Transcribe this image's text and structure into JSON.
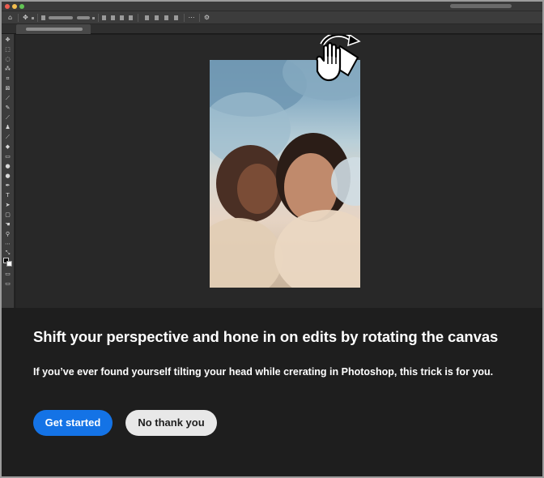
{
  "window": {
    "traffic_lights": [
      "close",
      "minimize",
      "zoom"
    ]
  },
  "options_bar": {
    "icons": [
      "home-icon",
      "move-tool-icon",
      "ellipsis-icon",
      "gear-icon"
    ]
  },
  "tools": [
    "move-tool-icon",
    "marquee-tool-icon",
    "lasso-tool-icon",
    "magic-wand-icon",
    "crop-tool-icon",
    "frame-tool-icon",
    "eyedropper-icon",
    "healing-brush-icon",
    "brush-icon",
    "clone-stamp-icon",
    "history-brush-icon",
    "eraser-icon",
    "gradient-icon",
    "blur-icon",
    "dodge-icon",
    "pen-icon",
    "type-icon",
    "path-selection-icon",
    "shape-icon",
    "hand-icon",
    "zoom-icon",
    "more-tools-icon"
  ],
  "canvas": {
    "cursor": "rotate-view-hand-icon",
    "photo": "portrait-photo"
  },
  "overlay": {
    "headline": "Shift your perspective and hone in on edits by rotating the canvas",
    "subtext": "If you’ve ever found yourself tilting your head while crerating in Photoshop, this trick is for you.",
    "primary_button": "Get started",
    "secondary_button": "No thank you"
  },
  "colors": {
    "panel_background": "#1e1e1e",
    "canvas_background": "#282828",
    "accent_blue": "#1473e6",
    "secondary_button": "#e8e8e8"
  }
}
